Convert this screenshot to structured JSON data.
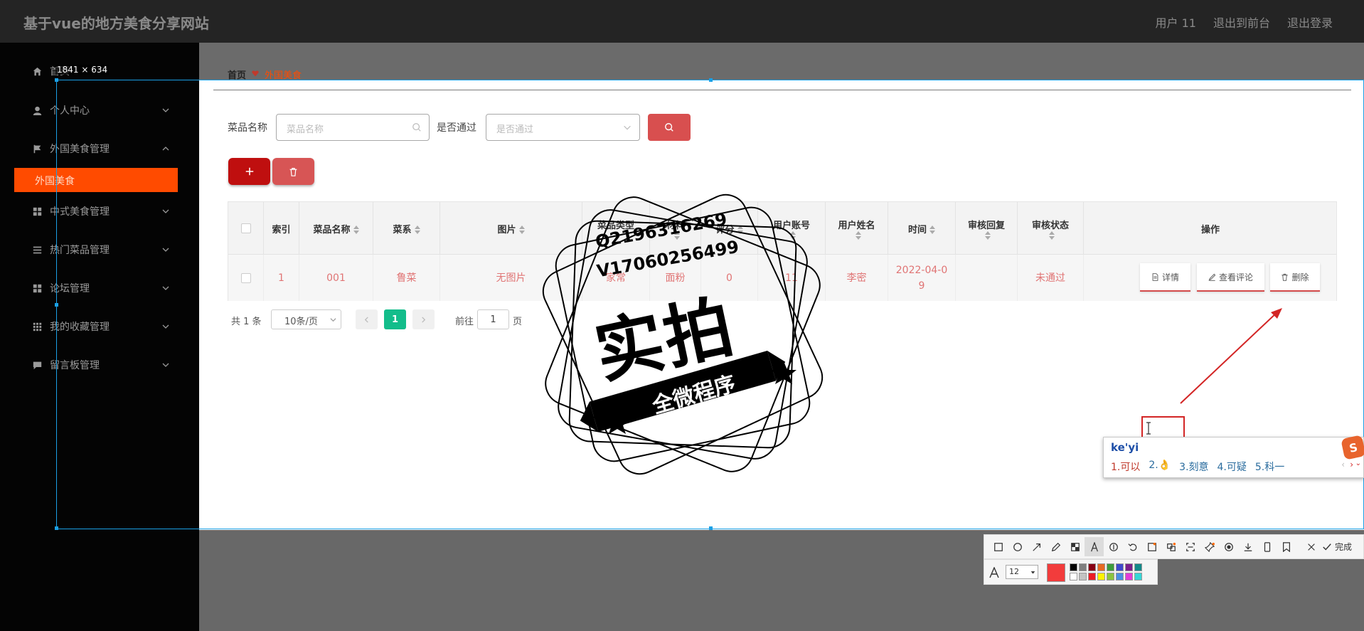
{
  "header": {
    "title": "基于vue的地方美食分享网站",
    "links": [
      "用户 11",
      "退出到前台",
      "退出登录"
    ]
  },
  "sidebar": {
    "size_label": "1841 × 634",
    "items": [
      {
        "label": "首页",
        "icon": "home-icon"
      },
      {
        "label": "个人中心",
        "icon": "user-icon"
      },
      {
        "label": "外国美食管理",
        "icon": "flag-icon"
      },
      {
        "label": "中式美食管理",
        "icon": "grid-icon"
      },
      {
        "label": "热门菜品管理",
        "icon": "list-icon"
      },
      {
        "label": "论坛管理",
        "icon": "grid-icon"
      },
      {
        "label": "我的收藏管理",
        "icon": "apps-icon"
      },
      {
        "label": "留言板管理",
        "icon": "chat-icon"
      }
    ],
    "active_sub": "外国美食"
  },
  "breadcrumb": {
    "home": "首页",
    "current": "外国美食"
  },
  "search": {
    "name_label": "菜品名称",
    "name_placeholder": "菜品名称",
    "pass_label": "是否通过",
    "pass_placeholder": "是否通过"
  },
  "table": {
    "headers": [
      "索引",
      "菜品名称",
      "菜系",
      "图片",
      "菜品类型",
      "材料",
      "评分",
      "用户账号",
      "用户姓名",
      "时间",
      "审核回复",
      "审核状态",
      "操作"
    ],
    "rows": [
      {
        "index": "1",
        "name": "001",
        "cuisine": "鲁菜",
        "image": "无图片",
        "type": "家常",
        "material": "面粉",
        "score": "0",
        "account": "11",
        "username": "李密",
        "time": "2022-04-09",
        "reply": "",
        "status": "未通过"
      }
    ],
    "ops": [
      "详情",
      "查看评论",
      "删除"
    ]
  },
  "pagination": {
    "total": "共 1 条",
    "page_size": "10条/页",
    "current": "1",
    "goto_label": "前往",
    "goto_value": "1",
    "page_unit": "页"
  },
  "stamp": {
    "line1": "Q2196316269",
    "line2": "V17060256499",
    "main": "实拍",
    "banner": "全微程序"
  },
  "ime": {
    "input": "ke'yi",
    "candidates": [
      "1.可以",
      "2.👌",
      "3.刻意",
      "4.可疑",
      "5.科一"
    ]
  },
  "toolbar": {
    "done": "完成",
    "font_size": "12"
  },
  "colors": {
    "accent": "#ff4b00",
    "danger": "#d84f4f",
    "page_active": "#13bd8b",
    "selection": "#1aa0e6"
  }
}
